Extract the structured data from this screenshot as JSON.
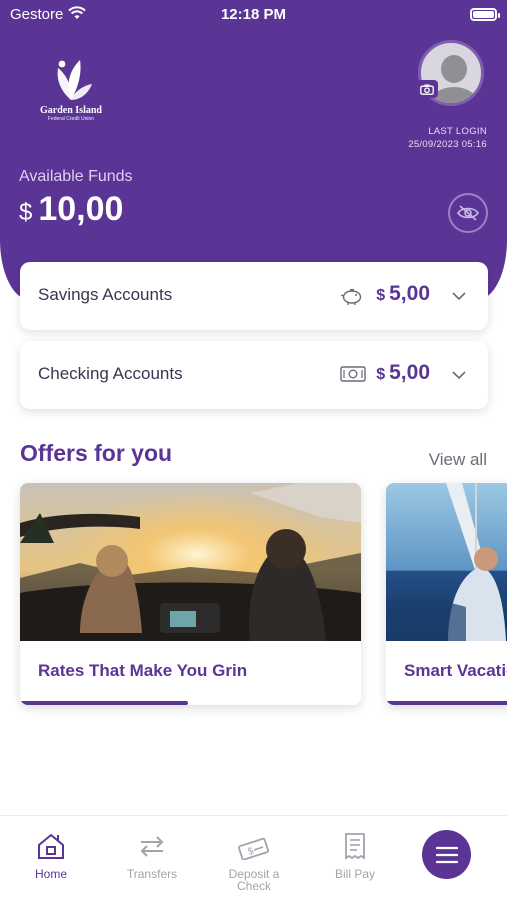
{
  "status_bar": {
    "carrier": "Gestore",
    "time": "12:18 PM"
  },
  "brand": {
    "name": "Garden Island",
    "tagline": "Federal Credit Union"
  },
  "header": {
    "last_login_label": "LAST LOGIN",
    "last_login_value": "25/09/2023 05:16",
    "available_funds_label": "Available Funds",
    "available_funds_currency": "$",
    "available_funds_amount": "10,00"
  },
  "accounts": [
    {
      "name": "Savings Accounts",
      "currency": "$",
      "amount": "5,00",
      "icon": "piggy-bank-icon"
    },
    {
      "name": "Checking Accounts",
      "currency": "$",
      "amount": "5,00",
      "icon": "cash-icon"
    }
  ],
  "offers": {
    "title": "Offers for you",
    "view_all": "View all",
    "items": [
      {
        "title": "Rates That Make You Grin"
      },
      {
        "title": "Smart Vacatio"
      }
    ]
  },
  "tabbar": {
    "items": [
      {
        "label": "Home",
        "icon": "home-icon",
        "active": true
      },
      {
        "label": "Transfers",
        "icon": "transfers-icon",
        "active": false
      },
      {
        "label": "Deposit a Check",
        "icon": "deposit-check-icon",
        "active": false
      },
      {
        "label": "Bill Pay",
        "icon": "bill-pay-icon",
        "active": false
      }
    ],
    "menu_icon": "hamburger-menu-icon"
  },
  "colors": {
    "brand_purple": "#5b3596",
    "text_dark": "#3a3550",
    "muted": "#a4a2ad"
  }
}
